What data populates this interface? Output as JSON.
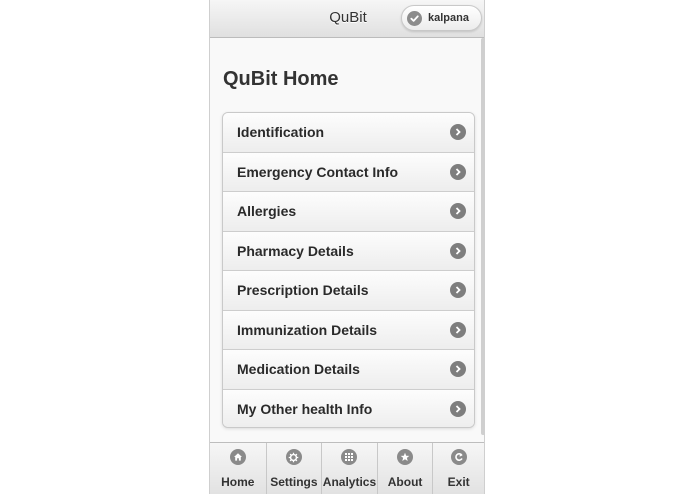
{
  "header": {
    "title": "QuBit",
    "user_label": "kalpana"
  },
  "page": {
    "title": "QuBit Home"
  },
  "menu": {
    "items": [
      {
        "label": "Identification"
      },
      {
        "label": "Emergency Contact Info"
      },
      {
        "label": "Allergies"
      },
      {
        "label": "Pharmacy Details"
      },
      {
        "label": "Prescription Details"
      },
      {
        "label": "Immunization Details"
      },
      {
        "label": "Medication Details"
      },
      {
        "label": "My Other health Info"
      }
    ]
  },
  "footer": {
    "items": [
      {
        "label": "Home",
        "icon": "home-icon"
      },
      {
        "label": "Settings",
        "icon": "gear-icon"
      },
      {
        "label": "Analytics",
        "icon": "grid-icon"
      },
      {
        "label": "About",
        "icon": "star-icon"
      },
      {
        "label": "Exit",
        "icon": "back-icon"
      }
    ]
  },
  "colors": {
    "icon_gray": "#8a8a8a",
    "text_dark": "#333333"
  }
}
